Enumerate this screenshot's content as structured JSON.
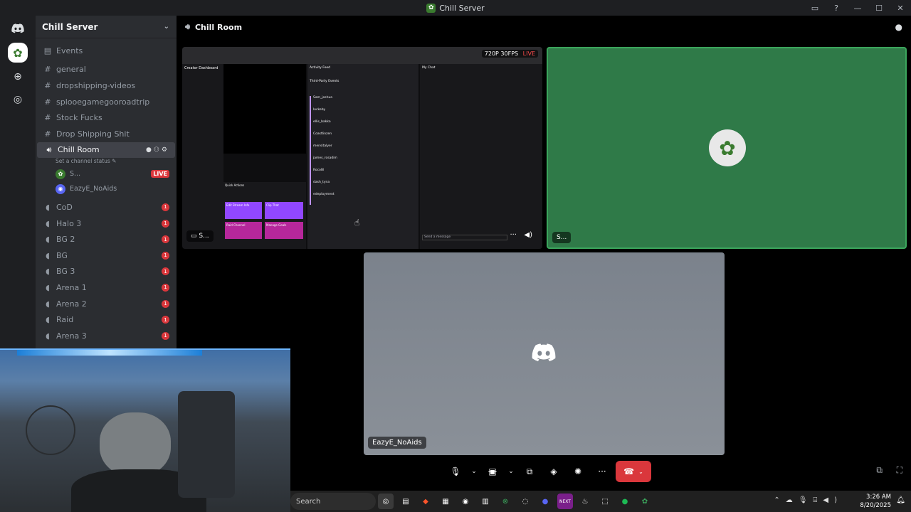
{
  "window": {
    "title": "Chill Server"
  },
  "server": {
    "name": "Chill Server"
  },
  "channels": {
    "events": "Events",
    "text": [
      "general",
      "dropshipping-videos",
      "splooegamegooroadtrip",
      "Stock Fucks",
      "Drop Shipping Shit"
    ],
    "active_voice": {
      "name": "Chill Room",
      "status": "Set a channel status"
    },
    "voice_members": [
      {
        "name": "S...",
        "live": "LIVE"
      },
      {
        "name": "EazyE_NoAids"
      }
    ],
    "voice": [
      {
        "name": "CoD",
        "badge": "1"
      },
      {
        "name": "Halo 3",
        "badge": "1"
      },
      {
        "name": "BG 2",
        "badge": "1"
      },
      {
        "name": "BG",
        "badge": "1"
      },
      {
        "name": "BG 3",
        "badge": "1"
      },
      {
        "name": "Arena 1",
        "badge": "1"
      },
      {
        "name": "Arena 2",
        "badge": "1"
      },
      {
        "name": "Raid",
        "badge": "1"
      },
      {
        "name": "Arena 3",
        "badge": "1"
      }
    ]
  },
  "stage": {
    "title": "Chill Room",
    "stream_quality": "720P 30FPS",
    "stream_live": "LIVE",
    "tile1_name": "S...",
    "tile2_name": "S...",
    "tile3_name": "EazyE_NoAids",
    "stream_content": {
      "dashboard": "Creator Dashboard",
      "activity_feed": "Activity Feed",
      "my_chat": "My Chat",
      "third_party": "Third-Party Events",
      "quick_actions": "Quick Actions",
      "edit_stream_info": "Edit Stream Info",
      "clip_that": "Clip That",
      "raid_channel": "Raid Channel",
      "manage_goals": "Manage Goals",
      "send_message": "Send a message",
      "followers": [
        "Sam_joshua",
        "lockeby",
        "ellis_bakka",
        "Coastlinzen",
        "mensitalyer",
        "james_rosadim",
        "Rocol8",
        "dash_tyna",
        "edeployment"
      ]
    }
  },
  "taskbar": {
    "search": "Search",
    "time": "3:26 AM",
    "date": "8/20/2025"
  },
  "colors": {
    "accent_green": "#3ba55c",
    "danger": "#da373c",
    "sidebar": "#2b2d31"
  }
}
